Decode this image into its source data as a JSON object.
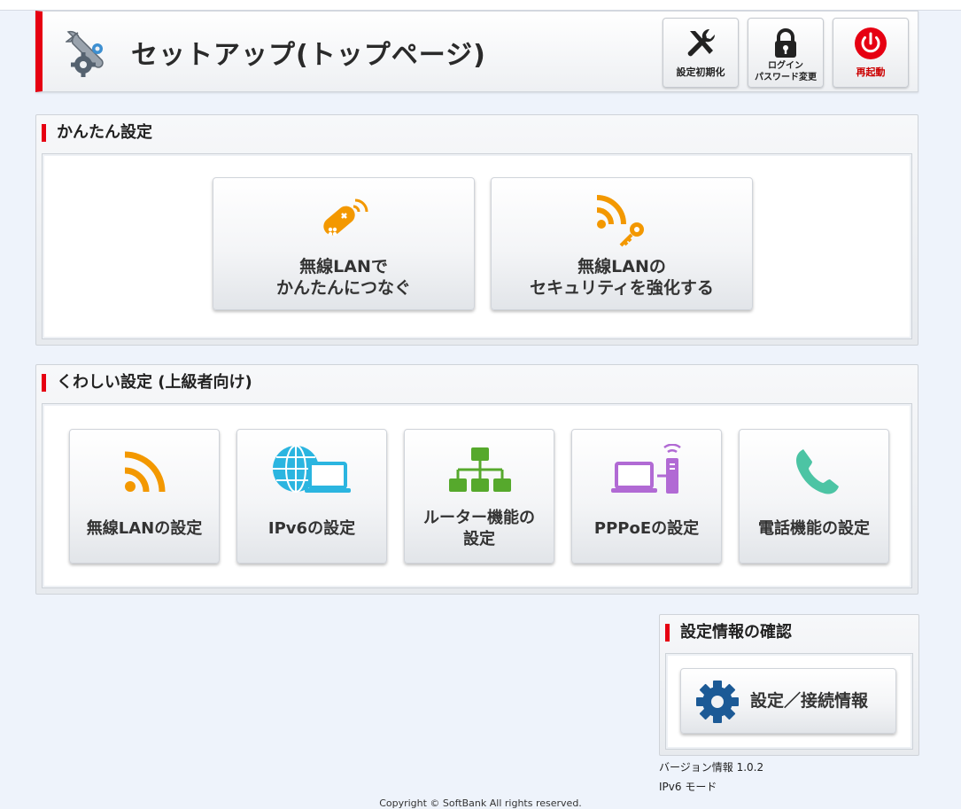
{
  "header": {
    "title": "セットアップ(トップページ)",
    "buttons": [
      {
        "label": "設定初期化",
        "icon": "tools-icon"
      },
      {
        "label": "ログイン\nパスワード変更",
        "icon": "lock-icon"
      },
      {
        "label": "再起動",
        "icon": "power-icon"
      }
    ]
  },
  "easy": {
    "title": "かんたん設定",
    "buttons": [
      {
        "label": "無線LANで\nかんたんにつなぐ",
        "icon": "remote-signal-icon"
      },
      {
        "label": "無線LANの\nセキュリティを強化する",
        "icon": "wifi-key-icon"
      }
    ]
  },
  "advanced": {
    "title": "くわしい設定 (上級者向け)",
    "buttons": [
      {
        "label": "無線LANの設定",
        "icon": "wifi-icon"
      },
      {
        "label": "IPv6の設定",
        "icon": "globe-laptop-icon"
      },
      {
        "label": "ルーター機能の\n設定",
        "icon": "network-tree-icon"
      },
      {
        "label": "PPPoEの設定",
        "icon": "laptop-router-icon"
      },
      {
        "label": "電話機能の設定",
        "icon": "phone-icon"
      }
    ]
  },
  "info": {
    "title": "設定情報の確認",
    "button": {
      "label": "設定／接続情報",
      "icon": "gear-icon"
    }
  },
  "version": {
    "line1": "バージョン情報 1.0.2",
    "line2": "IPv6 モード"
  },
  "copyright": "Copyright © SoftBank All rights reserved.",
  "colors": {
    "accent_red": "#e60012",
    "icon_orange": "#f39800",
    "icon_blue": "#2bb5e0",
    "icon_green": "#56a92c",
    "icon_purple": "#b16ad4",
    "icon_teal": "#4cc4a4",
    "gear_blue": "#1c5a96"
  }
}
